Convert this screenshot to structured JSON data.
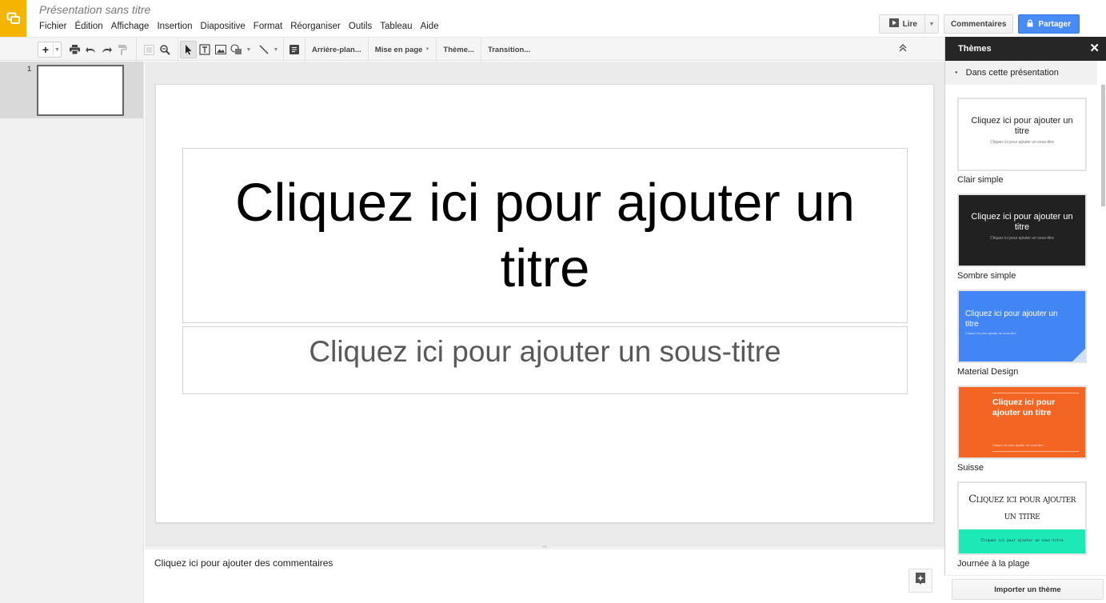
{
  "app": {
    "doc_title": "Présentation sans titre",
    "logo_icon": "slides-logo-icon",
    "brand_color": "#f4b400"
  },
  "menu": [
    "Fichier",
    "Édition",
    "Affichage",
    "Insertion",
    "Diapositive",
    "Format",
    "Réorganiser",
    "Outils",
    "Tableau",
    "Aide"
  ],
  "header_buttons": {
    "present_label": "Lire",
    "comments_label": "Commentaires",
    "share_label": "Partager",
    "share_color": "#4a8af4"
  },
  "toolbar": {
    "new_slide": "+",
    "background_label": "Arrière-plan...",
    "layout_label": "Mise en page",
    "theme_label": "Thème...",
    "transition_label": "Transition..."
  },
  "filmstrip": {
    "slides": [
      {
        "number": "1"
      }
    ]
  },
  "slide": {
    "title_placeholder": "Cliquez ici pour ajouter un titre",
    "subtitle_placeholder": "Cliquez ici pour ajouter un sous-titre"
  },
  "notes": {
    "placeholder": "Cliquez ici pour ajouter des commentaires"
  },
  "themes_panel": {
    "title": "Thèmes",
    "close": "✕",
    "section": "Dans cette présentation",
    "themes": [
      {
        "name": "Clair simple",
        "title": "Cliquez ici pour ajouter un titre",
        "subtitle": "Cliquez ici pour ajouter un sous-titre",
        "bg": "#ffffff",
        "fg": "#222222"
      },
      {
        "name": "Sombre simple",
        "title": "Cliquez ici pour ajouter un titre",
        "subtitle": "Cliquez ici pour ajouter un sous-titre",
        "bg": "#212121",
        "fg": "#ffffff"
      },
      {
        "name": "Material Design",
        "title": "Cliquez ici pour ajouter un titre",
        "subtitle": "Cliquez ici pour ajouter un sous-titre",
        "bg": "#4285f4",
        "fg": "#ffffff"
      },
      {
        "name": "Suisse",
        "title": "Cliquez ici pour ajouter un titre",
        "subtitle": "Cliquez ici pour ajouter un sous-titre",
        "bg": "#f26522",
        "fg": "#ffffff"
      },
      {
        "name": "Journée à la plage",
        "title": "Cliquez ici pour ajouter un titre",
        "subtitle": "Cliquez ici pour ajouter un sous-titre",
        "bg": "#ffffff",
        "fg": "#222222",
        "band": "#1de9b6"
      }
    ],
    "import_label": "Importer un thème"
  }
}
